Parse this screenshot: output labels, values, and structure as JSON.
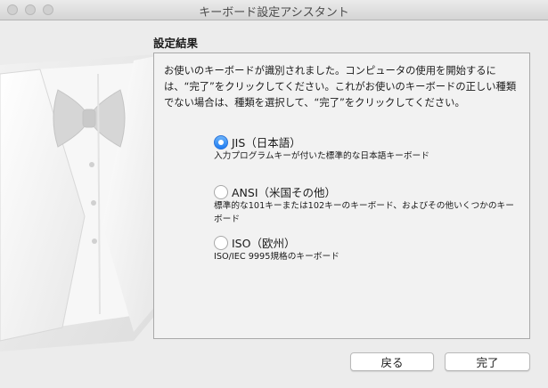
{
  "window": {
    "title": "キーボード設定アシスタント"
  },
  "section": {
    "heading": "設定結果"
  },
  "description": "お使いのキーボードが識別されました。コンピュータの使用を開始するに\nは、“完了”をクリックしてください。これがお使いのキーボードの正しい種類\nでない場合は、種類を選択して、“完了”をクリックしてください。",
  "options": [
    {
      "label": "JIS（日本語）",
      "description": "入力プログラムキーが付いた標準的な日本語キーボード",
      "selected": true
    },
    {
      "label": "ANSI（米国その他）",
      "description": "標準的な101キーまたは102キーのキーボード、およびその他いくつかのキーボード",
      "selected": false
    },
    {
      "label": "ISO（欧州）",
      "description": "ISO/IEC 9995規格のキーボード",
      "selected": false
    }
  ],
  "buttons": {
    "back": "戻る",
    "done": "完了"
  },
  "colors": {
    "accent": "#1e7cf2",
    "window_bg": "#ececec",
    "panel_bg": "#f2f2f2"
  }
}
